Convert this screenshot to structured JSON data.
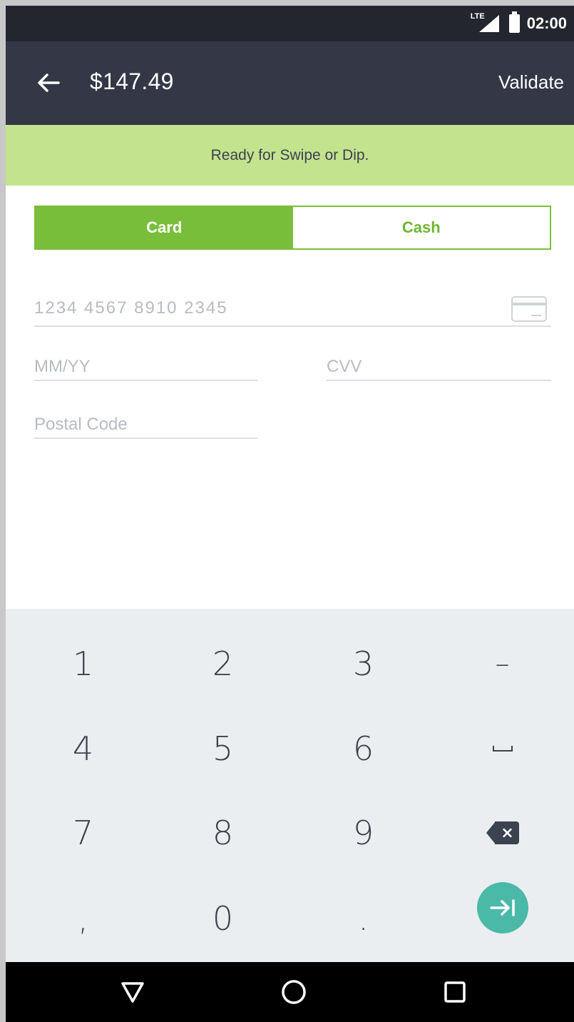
{
  "status_bar": {
    "network_label": "LTE",
    "time": "02:00"
  },
  "app_bar": {
    "amount": "$147.49",
    "validate_label": "Validate"
  },
  "banner": {
    "message": "Ready for Swipe or Dip."
  },
  "payment_tabs": [
    {
      "label": "Card",
      "selected": true
    },
    {
      "label": "Cash",
      "selected": false
    }
  ],
  "form": {
    "card_number": {
      "value": "",
      "placeholder": "1234  4567  8910  2345"
    },
    "expiry": {
      "value": "",
      "placeholder": "MM/YY"
    },
    "cvv": {
      "value": "",
      "placeholder": "CVV"
    },
    "postal_code": {
      "value": "",
      "placeholder": "Postal Code"
    }
  },
  "keypad": {
    "keys": [
      "1",
      "2",
      "3",
      "–",
      "4",
      "5",
      "6",
      "7",
      "8",
      "9",
      ",",
      "0",
      "."
    ],
    "icons": [
      "space-icon",
      "backspace-icon",
      "next-field-icon"
    ]
  },
  "colors": {
    "status_bar": "#23262e",
    "app_bar": "#333746",
    "banner": "#c4e38f",
    "accent_green": "#79be3a",
    "next_button": "#4ab9a8",
    "keypad_bg": "#ebeef1"
  }
}
